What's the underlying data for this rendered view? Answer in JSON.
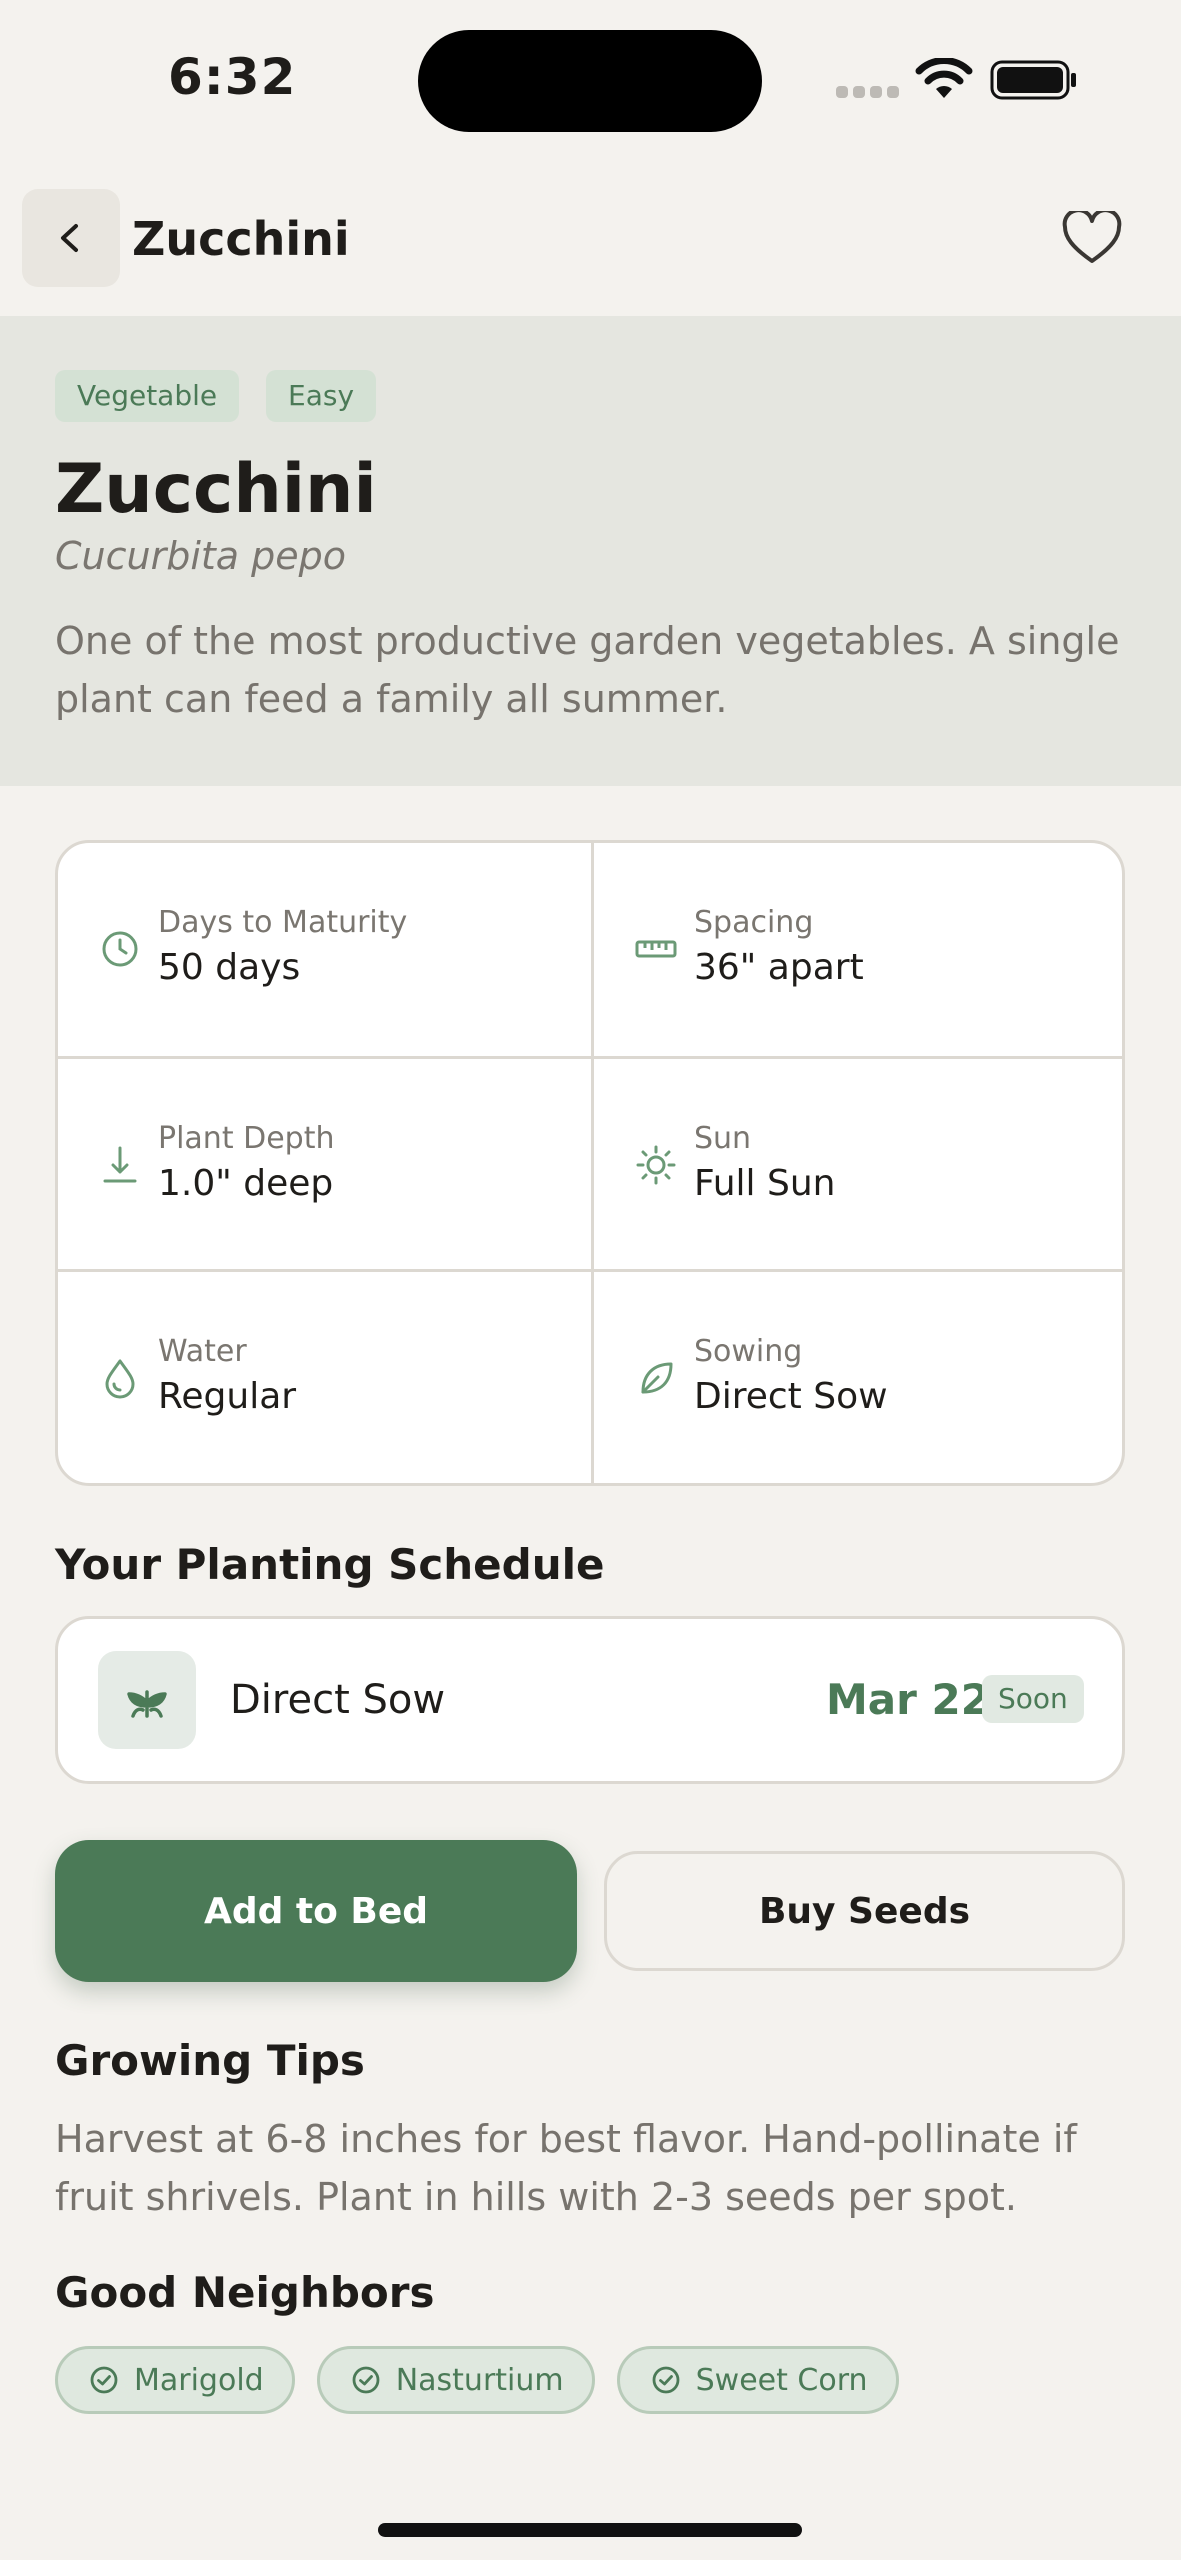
{
  "status_bar": {
    "time": "6:32"
  },
  "header": {
    "title": "Zucchini",
    "back_icon": "chevron-left-icon",
    "favorite_icon": "heart-outline-icon"
  },
  "hero": {
    "tags": [
      "Vegetable",
      "Easy"
    ],
    "title": "Zucchini",
    "latin_name": "Cucurbita pepo",
    "description": "One of the most productive garden vegetables. A single plant can feed a family all summer."
  },
  "stats": [
    {
      "label": "Days to Maturity",
      "value": "50 days",
      "icon": "clock-icon"
    },
    {
      "label": "Spacing",
      "value": "36\" apart",
      "icon": "ruler-icon"
    },
    {
      "label": "Plant Depth",
      "value": "1.0\" deep",
      "icon": "depth-arrow-icon"
    },
    {
      "label": "Sun",
      "value": "Full Sun",
      "icon": "sun-icon"
    },
    {
      "label": "Water",
      "value": "Regular",
      "icon": "water-drop-icon"
    },
    {
      "label": "Sowing",
      "value": "Direct Sow",
      "icon": "leaf-icon"
    }
  ],
  "schedule": {
    "title": "Your Planting Schedule",
    "method": "Direct Sow",
    "date": "Mar 22",
    "badge": "Soon",
    "icon": "sprout-icon"
  },
  "actions": {
    "add_label": "Add to Bed",
    "buy_label": "Buy Seeds"
  },
  "tips": {
    "title": "Growing Tips",
    "text": "Harvest at 6-8 inches for best flavor. Hand-pollinate if fruit shrivels. Plant in hills with 2-3 seeds per spot."
  },
  "neighbors": {
    "title": "Good Neighbors",
    "items": [
      "Marigold",
      "Nasturtium",
      "Sweet Corn"
    ],
    "icon": "check-circle-icon"
  },
  "colors": {
    "background": "#f4f2ee",
    "hero_background": "#e5e6e0",
    "accent_green": "#4b7a57",
    "tag_background": "#d4e1d4",
    "card_border": "#dcd8d1",
    "muted_text": "#77736d"
  }
}
